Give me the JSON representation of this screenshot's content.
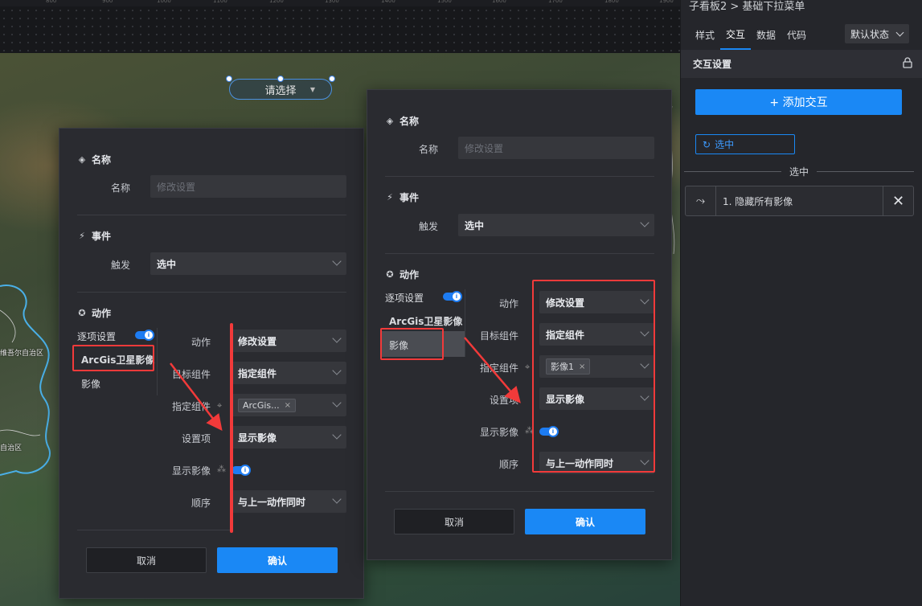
{
  "ruler": {
    "ticks": [
      "800",
      "900",
      "1000",
      "1100",
      "1200",
      "1300",
      "1400",
      "1500",
      "1600",
      "1700",
      "1800",
      "1900"
    ]
  },
  "canvas": {
    "dropdown_placeholder": "请选择",
    "map_labels": [
      "维吾尔自治区",
      "自治区"
    ]
  },
  "dialog1": {
    "name_section": "名称",
    "name_label": "名称",
    "name_placeholder": "修改设置",
    "event_section": "事件",
    "trigger_label": "触发",
    "trigger_value": "选中",
    "action_section": "动作",
    "item_toggle_label": "逐项设置",
    "list": [
      "ArcGis卫星影像",
      "影像"
    ],
    "action_label": "动作",
    "action_value": "修改设置",
    "target_label": "目标组件",
    "target_value": "指定组件",
    "specify_label": "指定组件",
    "specify_tag": "ArcGis...",
    "setting_label": "设置项",
    "setting_value": "显示影像",
    "show_label": "显示影像",
    "order_label": "顺序",
    "order_value": "与上一动作同时",
    "cancel": "取消",
    "confirm": "确认"
  },
  "dialog2": {
    "name_section": "名称",
    "name_label": "名称",
    "name_placeholder": "修改设置",
    "event_section": "事件",
    "trigger_label": "触发",
    "trigger_value": "选中",
    "action_section": "动作",
    "item_toggle_label": "逐项设置",
    "list": [
      "ArcGis卫星影像",
      "影像"
    ],
    "action_label": "动作",
    "action_value": "修改设置",
    "target_label": "目标组件",
    "target_value": "指定组件",
    "specify_label": "指定组件",
    "specify_tag": "影像1",
    "setting_label": "设置项",
    "setting_value": "显示影像",
    "show_label": "显示影像",
    "order_label": "顺序",
    "order_value": "与上一动作同时",
    "cancel": "取消",
    "confirm": "确认"
  },
  "panel": {
    "breadcrumb": "子看板2 > 基础下拉菜单",
    "tabs": [
      "样式",
      "交互",
      "数据",
      "代码"
    ],
    "state": "默认状态",
    "section_title": "交互设置",
    "add_button": "+ 添加交互",
    "event_chip": "选中",
    "separator": "选中",
    "action_item": "1. 隐藏所有影像"
  },
  "colors": {
    "accent": "#1a88f5",
    "highlight": "#f23a3a",
    "panel_bg": "#25262b",
    "dialog_bg": "#2a2b30"
  }
}
